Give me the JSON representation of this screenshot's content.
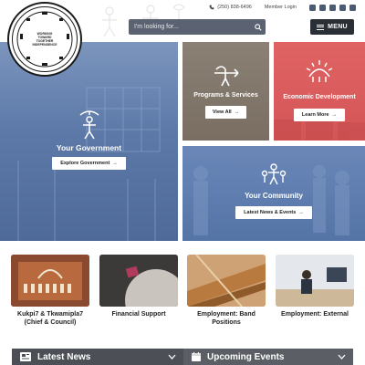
{
  "header": {
    "phone": "(250) 838-6496",
    "member_login": "Member Login",
    "social_icons": [
      "facebook-icon",
      "instagram-icon",
      "twitter-icon",
      "youtube-icon",
      "linkedin-icon"
    ],
    "search_placeholder": "I'm looking for...",
    "menu_label": "MENU"
  },
  "logo": {
    "lines": [
      "WORKING",
      "TOWARD",
      "TOGETHER",
      "INDEPENDENCE"
    ]
  },
  "tiles": {
    "government": {
      "title": "Your Government",
      "button": "Explore Government"
    },
    "programs": {
      "title": "Programs & Services",
      "button": "View All"
    },
    "economic": {
      "title": "Economic Development",
      "button": "Learn More"
    },
    "community": {
      "title": "Your Community",
      "button": "Latest News & Events"
    }
  },
  "cards": [
    {
      "caption_line1": "Kukpi7 & Tkwamipla7",
      "caption_line2": "(Chief & Council)"
    },
    {
      "caption_line1": "Financial Support",
      "caption_line2": ""
    },
    {
      "caption_line1": "Employment: Band",
      "caption_line2": "Positions"
    },
    {
      "caption_line1": "Employment: External",
      "caption_line2": ""
    }
  ],
  "bars": {
    "news": "Latest News",
    "events": "Upcoming Events"
  },
  "colors": {
    "government_tile": "#5d79a8",
    "programs_tile": "#7a6e63",
    "economic_tile": "#d45556",
    "community_tile": "#5574a6",
    "menu_button": "#2a2e35",
    "search_bar": "#5b6372",
    "news_bar": "#4c4f55"
  }
}
